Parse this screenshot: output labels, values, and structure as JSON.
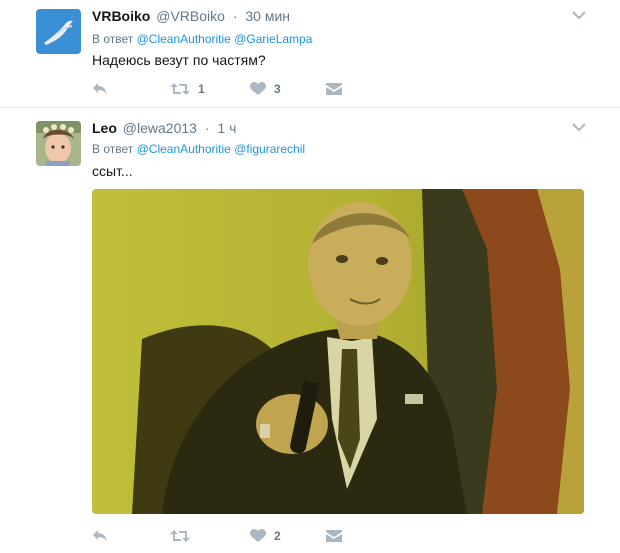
{
  "tweets": [
    {
      "name": "VRBoiko",
      "handle": "@VRBoiko",
      "separator": "·",
      "time": "30 мин",
      "reply_prefix": "В ответ",
      "reply_to": [
        "@CleanAuthoritie",
        "@GarieLampa"
      ],
      "text": "Надеюсь везут по частям?",
      "retweets": "1",
      "likes": "3",
      "avatar_icon": "bird-avatar"
    },
    {
      "name": "Leo",
      "handle": "@lewa2013",
      "separator": "·",
      "time": "1 ч",
      "reply_prefix": "В ответ",
      "reply_to": [
        "@CleanAuthoritie",
        "@figurarechil"
      ],
      "text": "ссыт...",
      "retweets": "",
      "likes": "2",
      "avatar_icon": "child-avatar",
      "media": "photo-man-with-microphone"
    }
  ],
  "colors": {
    "link": "#1b95e0",
    "secondary": "#657786",
    "icon": "#aab8c2",
    "text": "#14171a"
  }
}
